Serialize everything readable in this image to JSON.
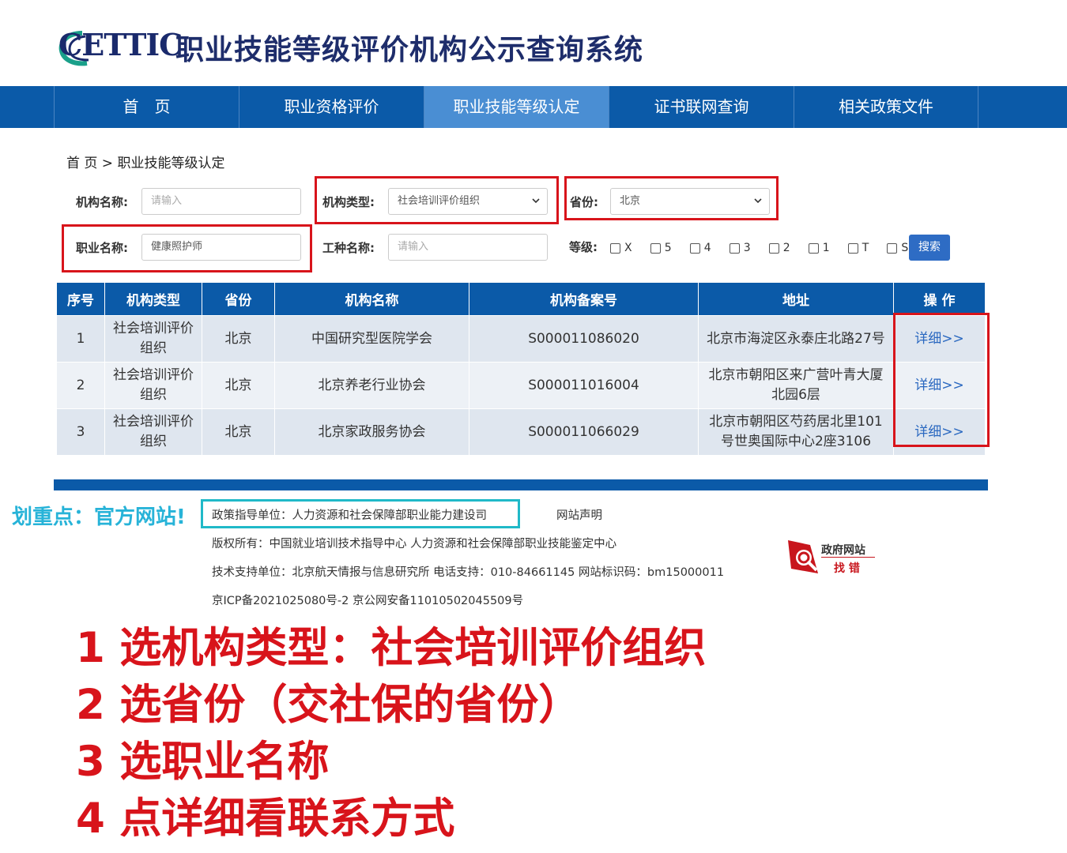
{
  "header": {
    "logo_text": "CETTIC",
    "title": "职业技能等级评价机构公示查询系统"
  },
  "nav": {
    "items": [
      {
        "label": "首　页",
        "active": false
      },
      {
        "label": "职业资格评价",
        "active": false
      },
      {
        "label": "职业技能等级认定",
        "active": true
      },
      {
        "label": "证书联网查询",
        "active": false
      },
      {
        "label": "相关政策文件",
        "active": false
      }
    ]
  },
  "breadcrumb": "首  页 > 职业技能等级认定",
  "filters": {
    "org_name_label": "机构名称:",
    "org_name_placeholder": "请输入",
    "org_type_label": "机构类型:",
    "org_type_value": "社会培训评价组织",
    "province_label": "省份:",
    "province_value": "北京",
    "occupation_label": "职业名称:",
    "occupation_value": "健康照护师",
    "job_label": "工种名称:",
    "job_placeholder": "请输入",
    "level_label": "等级:",
    "levels": [
      "X",
      "5",
      "4",
      "3",
      "2",
      "1",
      "T",
      "S"
    ],
    "search_button": "搜索"
  },
  "table": {
    "headers": [
      "序号",
      "机构类型",
      "省份",
      "机构名称",
      "机构备案号",
      "地址",
      "操  作"
    ],
    "rows": [
      {
        "no": "1",
        "type_l1": "社会培训评价",
        "type_l2": "组织",
        "province": "北京",
        "name": "中国研究型医院学会",
        "record": "S000011086020",
        "addr_l1": "北京市海淀区永泰庄北路27号",
        "addr_l2": "",
        "action": "详细>>"
      },
      {
        "no": "2",
        "type_l1": "社会培训评价",
        "type_l2": "组织",
        "province": "北京",
        "name": "北京养老行业协会",
        "record": "S000011016004",
        "addr_l1": "北京市朝阳区来广营叶青大厦",
        "addr_l2": "北园6层",
        "action": "详细>>"
      },
      {
        "no": "3",
        "type_l1": "社会培训评价",
        "type_l2": "组织",
        "province": "北京",
        "name": "北京家政服务协会",
        "record": "S000011066029",
        "addr_l1": "北京市朝阳区芍药居北里101",
        "addr_l2": "号世奥国际中心2座3106",
        "action": "详细>>"
      }
    ]
  },
  "footer": {
    "highlight_note": "划重点：官方网站!",
    "policy_unit": "政策指导单位：人力资源和社会保障部职业能力建设司",
    "statement": "网站声明",
    "copyright": "版权所有：中国就业培训技术指导中心  人力资源和社会保障部职业技能鉴定中心",
    "tech_support": "技术支持单位：北京航天情报与信息研究所   电话支持：010-84661145   网站标识码：bm15000011",
    "icp": "京ICP备2021025080号-2    京公网安备11010502045509号",
    "gov_badge_line1": "政府网站",
    "gov_badge_line2": "找 错"
  },
  "steps": [
    "1 选机构类型：社会培训评价组织",
    "2 选省份（交社保的省份）",
    "3 选职业名称",
    "4 点详细看联系方式"
  ],
  "colors": {
    "nav_blue": "#0b5aa8",
    "nav_active": "#4a8ed3",
    "highlight_red": "#d8141b",
    "note_teal": "#27b3d8"
  }
}
